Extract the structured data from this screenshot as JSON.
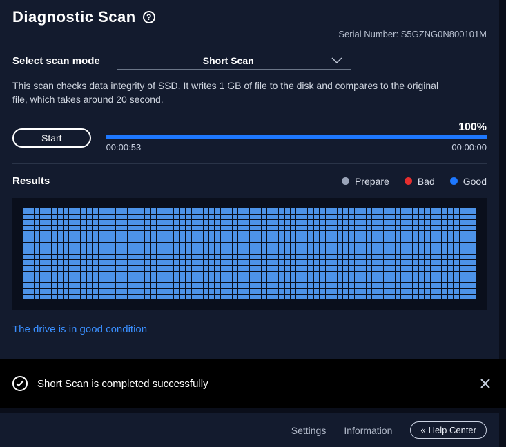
{
  "header": {
    "title": "Diagnostic Scan",
    "serial_label": "Serial Number:",
    "serial_value": "S5GZNG0N800101M"
  },
  "mode": {
    "label": "Select scan mode",
    "selected": "Short Scan"
  },
  "description": "This scan checks data integrity of SSD. It writes 1 GB of file to the disk and compares to the original file, which takes around 20 second.",
  "progress": {
    "start_label": "Start",
    "percent": "100%",
    "elapsed": "00:00:53",
    "remaining": "00:00:00",
    "fill_percent": 100
  },
  "results": {
    "label": "Results",
    "legend": {
      "prepare": "Prepare",
      "bad": "Bad",
      "good": "Good"
    },
    "grid": {
      "cols": 78,
      "rows": 16,
      "all_status": "good"
    },
    "status_text": "The drive is in good condition"
  },
  "toast": {
    "message": "Short Scan is completed successfully"
  },
  "footer": {
    "settings": "Settings",
    "information": "Information",
    "help_center": "Help Center"
  },
  "colors": {
    "accent": "#1e78ff",
    "bad": "#e62e2e",
    "prepare": "#9aa4b8",
    "good_cell": "#4d93e8"
  }
}
